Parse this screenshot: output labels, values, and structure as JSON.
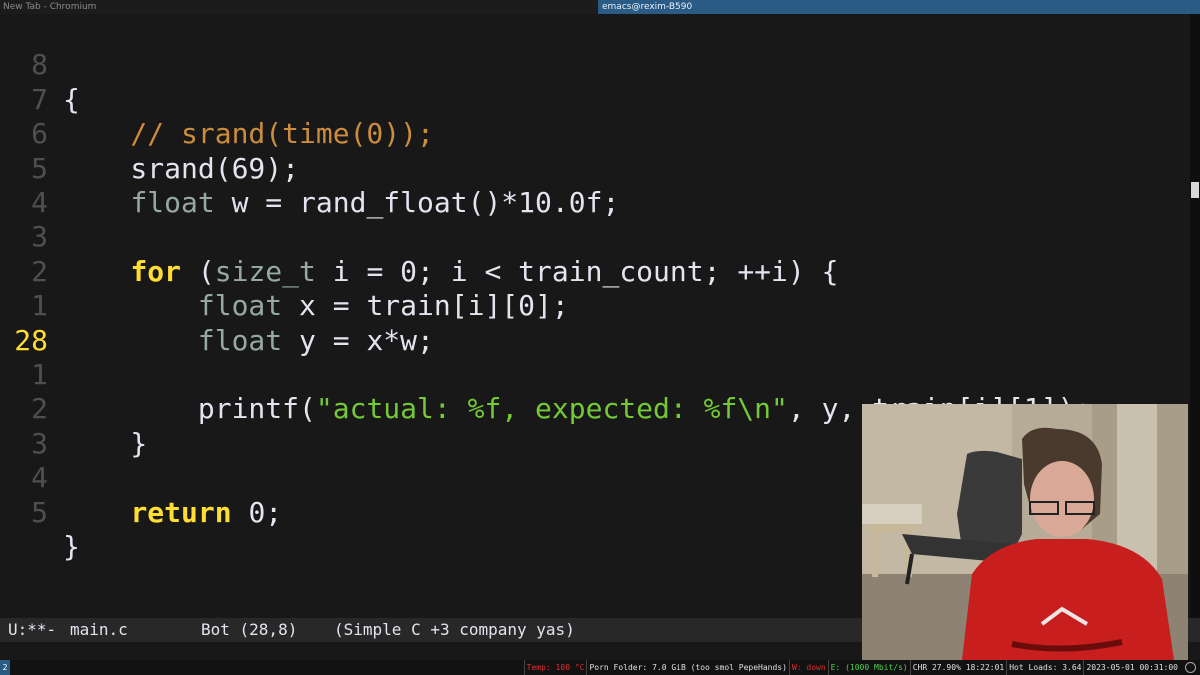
{
  "window_titles": {
    "browser": "New Tab - Chromium",
    "emacs": "emacs@rexim-B590"
  },
  "editor": {
    "lines": [
      {
        "number": "8",
        "current": false
      },
      {
        "number": "7",
        "current": false
      },
      {
        "number": "6",
        "current": false
      },
      {
        "number": "5",
        "current": false
      },
      {
        "number": "4",
        "current": false
      },
      {
        "number": "3",
        "current": false
      },
      {
        "number": "2",
        "current": false
      },
      {
        "number": "1",
        "current": false
      },
      {
        "number": "28",
        "current": true
      },
      {
        "number": "1",
        "current": false
      },
      {
        "number": "2",
        "current": false
      },
      {
        "number": "3",
        "current": false
      },
      {
        "number": "4",
        "current": false
      },
      {
        "number": "5",
        "current": false
      }
    ],
    "code": {
      "l0": "{",
      "l1": "    // srand(time(0));",
      "l2_a": "    srand(69);",
      "l3_type": "float",
      "l3_rest": " w = rand_float()*10.0f;",
      "l5_kw": "for",
      "l5_p1": " (",
      "l5_type": "size_t",
      "l5_rest": " i = 0; i < train_count; ++i) {",
      "l6_type": "float",
      "l6_rest": " x = train[i][0];",
      "l7_type": "float",
      "l7_rest": " y = x*w;",
      "l9_fn": "        printf(",
      "l9_str": "\"actual: %f, expected: %f\\n\"",
      "l9_rest": ", y, train[i][1]);",
      "l10": "    }",
      "l12_kw": "return",
      "l12_rest": " 0;",
      "l13": "}"
    },
    "colors": {
      "background": "#181818",
      "foreground": "#e4e4ef",
      "keyword": "#ffdd33",
      "type": "#95a99f",
      "comment": "#cc8c3c",
      "string": "#73c936"
    }
  },
  "modeline": {
    "state": "U:**-",
    "filename": "main.c",
    "position": "Bot (28,8)",
    "modes": "(Simple C +3 company yas)"
  },
  "statusbar": {
    "workspace": "2",
    "temp": "Temp: 100 °C",
    "folder": "Porn Folder: 7.0 GiB (too smol PepeHands)",
    "wifi": "W: down",
    "eth": "E: (1000 Mbit/s)",
    "battery": "CHR 27.90% 18:22:01",
    "loads": "Hot Loads: 3.64",
    "datetime": "2023-05-01 00:31:00"
  }
}
